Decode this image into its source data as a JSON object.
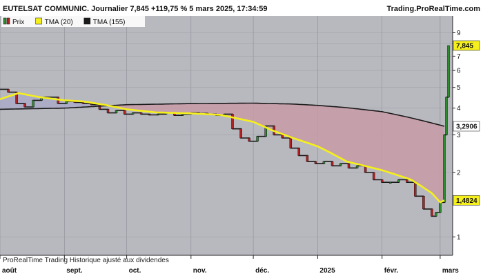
{
  "header": {
    "title": "EUTELSAT COMMUNIC. Journalier 7,845 +119,75 % 5 mars 2025, 17:34:59",
    "source": "Trading.ProRealTime.com"
  },
  "footer": {
    "text": "ProRealTime Trading  Historique ajusté aux dividendes"
  },
  "colors": {
    "background": "#b8b8bf",
    "tma20": "#f5f01c",
    "tma155": "#1a1a1a",
    "fill_red": "#c79aa6",
    "fill_blue": "#a9a9c7",
    "candle_up": "#2e8b2e",
    "candle_down": "#b22222",
    "price_tag_tma20": "#f5f01c",
    "price_tag_last": "#f5f01c"
  },
  "chart_data": {
    "type": "line",
    "title": "EUTELSAT COMMUNIC. Journalier",
    "y_scale": "log",
    "ylim": [
      0.82,
      10.8
    ],
    "y_ticks": [
      1,
      2,
      3,
      4,
      5,
      6,
      7,
      8,
      9
    ],
    "grid": true,
    "legend_position": "top-left",
    "legend": [
      {
        "label": "Prix",
        "color": "candle"
      },
      {
        "label": "TMA (20)",
        "color": "#f5f01c"
      },
      {
        "label": "TMA (155)",
        "color": "#1a1a1a"
      }
    ],
    "x_range": [
      "2024-08-01",
      "2025-03-07"
    ],
    "x_ticks": [
      {
        "label": "août",
        "date": "2024-08-01"
      },
      {
        "label": "sept.",
        "date": "2024-09-01"
      },
      {
        "label": "oct.",
        "date": "2024-10-01"
      },
      {
        "label": "nov.",
        "date": "2024-11-01"
      },
      {
        "label": "déc.",
        "date": "2024-12-01"
      },
      {
        "label": "2025",
        "date": "2025-01-01"
      },
      {
        "label": "févr.",
        "date": "2025-02-01"
      },
      {
        "label": "mars",
        "date": "2025-03-01"
      }
    ],
    "price": {
      "dates": [
        "2024-08-01",
        "2024-08-05",
        "2024-08-09",
        "2024-08-13",
        "2024-08-17",
        "2024-08-21",
        "2024-08-25",
        "2024-08-29",
        "2024-09-02",
        "2024-09-06",
        "2024-09-10",
        "2024-09-14",
        "2024-09-18",
        "2024-09-22",
        "2024-09-26",
        "2024-09-30",
        "2024-10-04",
        "2024-10-08",
        "2024-10-12",
        "2024-10-16",
        "2024-10-20",
        "2024-10-24",
        "2024-10-28",
        "2024-11-01",
        "2024-11-05",
        "2024-11-09",
        "2024-11-13",
        "2024-11-17",
        "2024-11-21",
        "2024-11-25",
        "2024-11-29",
        "2024-12-03",
        "2024-12-07",
        "2024-12-11",
        "2024-12-15",
        "2024-12-19",
        "2024-12-23",
        "2024-12-27",
        "2024-12-31",
        "2025-01-04",
        "2025-01-08",
        "2025-01-12",
        "2025-01-16",
        "2025-01-20",
        "2025-01-24",
        "2025-01-28",
        "2025-02-01",
        "2025-02-05",
        "2025-02-09",
        "2025-02-13",
        "2025-02-17",
        "2025-02-21",
        "2025-02-25",
        "2025-02-27",
        "2025-03-01",
        "2025-03-03",
        "2025-03-04",
        "2025-03-05"
      ],
      "values": [
        4.9,
        4.75,
        4.2,
        4.05,
        4.35,
        4.5,
        4.5,
        4.2,
        4.3,
        4.25,
        4.2,
        4.15,
        3.95,
        3.8,
        3.9,
        3.75,
        3.8,
        3.75,
        3.72,
        3.75,
        3.8,
        3.7,
        3.75,
        3.8,
        3.78,
        3.75,
        3.7,
        3.75,
        3.2,
        2.9,
        2.8,
        2.95,
        3.3,
        3.0,
        2.9,
        2.6,
        2.4,
        2.25,
        2.2,
        2.25,
        2.15,
        2.2,
        2.1,
        2.15,
        2.0,
        1.85,
        1.8,
        1.8,
        1.85,
        1.8,
        1.55,
        1.35,
        1.25,
        1.3,
        1.45,
        3.0,
        4.5,
        7.845
      ]
    },
    "tma20": {
      "dates": [
        "2024-08-01",
        "2024-08-10",
        "2024-08-20",
        "2024-09-01",
        "2024-09-10",
        "2024-09-20",
        "2024-10-01",
        "2024-10-15",
        "2024-11-01",
        "2024-11-15",
        "2024-12-01",
        "2024-12-10",
        "2024-12-20",
        "2025-01-01",
        "2025-01-15",
        "2025-02-01",
        "2025-02-15",
        "2025-02-25",
        "2025-03-01",
        "2025-03-03"
      ],
      "values": [
        4.4,
        4.7,
        4.5,
        4.35,
        4.3,
        4.15,
        3.95,
        3.82,
        3.78,
        3.72,
        3.45,
        3.15,
        2.9,
        2.65,
        2.25,
        2.05,
        1.85,
        1.6,
        1.45,
        1.4824
      ]
    },
    "tma155": {
      "dates": [
        "2024-08-01",
        "2024-09-01",
        "2024-10-01",
        "2024-11-01",
        "2024-12-01",
        "2024-12-20",
        "2025-01-01",
        "2025-01-15",
        "2025-02-01",
        "2025-02-15",
        "2025-03-03"
      ],
      "values": [
        3.95,
        4.0,
        4.15,
        4.2,
        4.22,
        4.18,
        4.12,
        4.02,
        3.85,
        3.6,
        3.2906
      ]
    },
    "price_labels": [
      {
        "text": "7,845",
        "value": 7.845,
        "style": "last"
      },
      {
        "text": "3,2906",
        "value": 3.2906,
        "style": "tma155"
      },
      {
        "text": "1,4824",
        "value": 1.4824,
        "style": "tma20"
      }
    ]
  }
}
